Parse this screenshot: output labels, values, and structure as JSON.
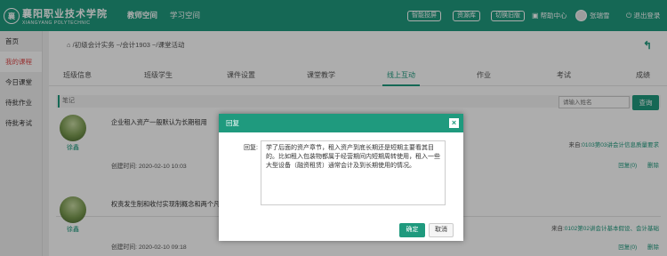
{
  "header": {
    "logo_cn": "襄阳职业技术学院",
    "logo_en": "XIANGYANG POLYTECHNIC",
    "nav": [
      "教师空间",
      "学习空间"
    ],
    "buttons": [
      "智能投屏",
      "资源库",
      "切换旧版"
    ],
    "help": "帮助中心",
    "user": "张瑞雪",
    "logout": "退出登录"
  },
  "sidebar": {
    "items": [
      "首页",
      "我的课程",
      "今日课堂",
      "待批作业",
      "待批考试"
    ]
  },
  "breadcrumb": "/初级会计实务 ~/会计1903 ~/课堂活动",
  "tabs": [
    "班级信息",
    "班级学生",
    "课件设置",
    "课堂教学",
    "线上互动",
    "作业",
    "考试",
    "成绩"
  ],
  "notes": {
    "label": "笔记",
    "search_placeholder": "请输入姓名",
    "search_button": "查询"
  },
  "posts": [
    {
      "name": "徐鑫",
      "text": "企业租入资产一般默认为长期租用",
      "time": "创建时间: 2020-02-10 10:03",
      "source_prefix": "来自:",
      "source_link": "0103第03讲会计信息质量要求",
      "reply": "回复(0)",
      "delete": "删除"
    },
    {
      "name": "徐鑫",
      "text": "权责发生制和收付实现制概念和两个凡是",
      "time": "创建时间: 2020-02-10 09:18",
      "source_prefix": "来自:",
      "source_link": "0102第02讲会计基本假设、会计基础",
      "reply": "回复(0)",
      "delete": "删除"
    }
  ],
  "modal": {
    "title": "回复",
    "label": "回复:",
    "text": "学了后面的资产章节，租入资产到底长期还是短期主要看其目的。比如租入包装物都属于经营期间内短期周转使用，租入一些大型设备（融资租赁）通常会计及到长期使用的情况。",
    "ok": "确定",
    "cancel": "取消"
  },
  "colors": {
    "primary": "#1f9a7e",
    "active_sidebar": "#e05050"
  }
}
